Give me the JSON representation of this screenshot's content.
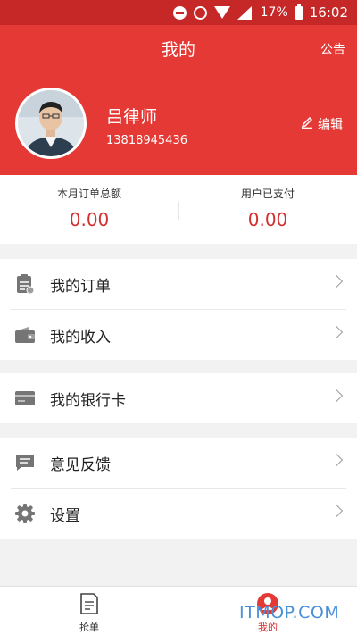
{
  "status_bar": {
    "battery_percent": "17%",
    "time": "16:02"
  },
  "header": {
    "title": "我的",
    "notice_label": "公告",
    "user_name": "吕律师",
    "user_phone": "13818945436",
    "edit_label": "编辑"
  },
  "stats": [
    {
      "label": "本月订单总额",
      "value": "0.00"
    },
    {
      "label": "用户已支付",
      "value": "0.00"
    }
  ],
  "menu": {
    "orders": {
      "label": "我的订单",
      "icon": "clipboard-icon"
    },
    "income": {
      "label": "我的收入",
      "icon": "wallet-icon"
    },
    "bank_card": {
      "label": "我的银行卡",
      "icon": "card-icon"
    },
    "feedback": {
      "label": "意见反馈",
      "icon": "message-icon"
    },
    "settings": {
      "label": "设置",
      "icon": "gear-icon"
    }
  },
  "bottom_nav": [
    {
      "label": "抢单",
      "icon": "document-icon",
      "active": false
    },
    {
      "label": "我的",
      "icon": "person-icon",
      "active": true
    }
  ],
  "watermark": "ITMOP.COM",
  "colors": {
    "header": "#e53935",
    "status_bar": "#c62828",
    "accent": "#d32f2f"
  }
}
